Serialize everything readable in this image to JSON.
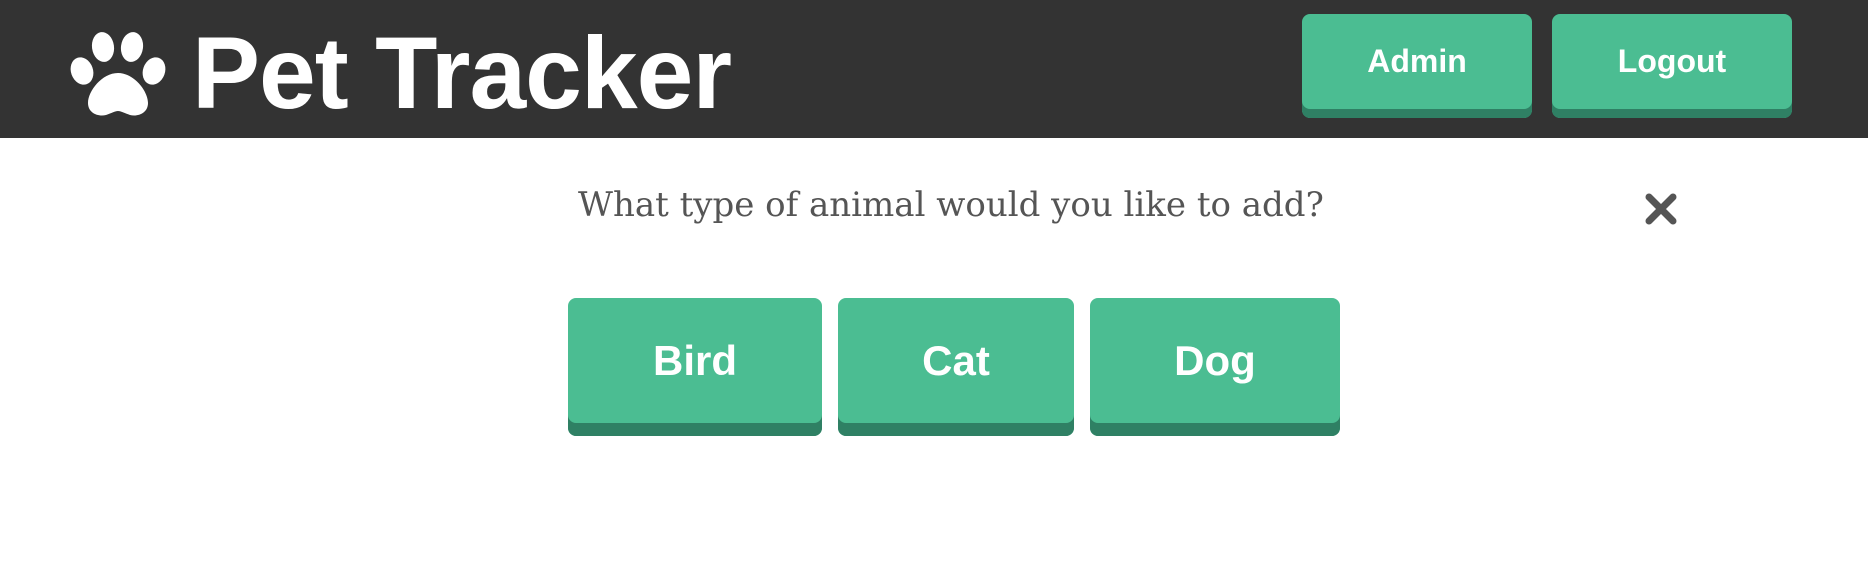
{
  "header": {
    "logo_icon": "paw-icon",
    "title": "Pet Tracker",
    "admin_label": "Admin",
    "logout_label": "Logout"
  },
  "dialog": {
    "question": "What type of animal would you like to add?",
    "close_icon": "close-icon",
    "options": [
      "Bird",
      "Cat",
      "Dog"
    ]
  },
  "colors": {
    "header_bg": "#333333",
    "accent": "#4bbd92",
    "accent_shadow": "#2f8064",
    "text_muted": "#555555"
  }
}
